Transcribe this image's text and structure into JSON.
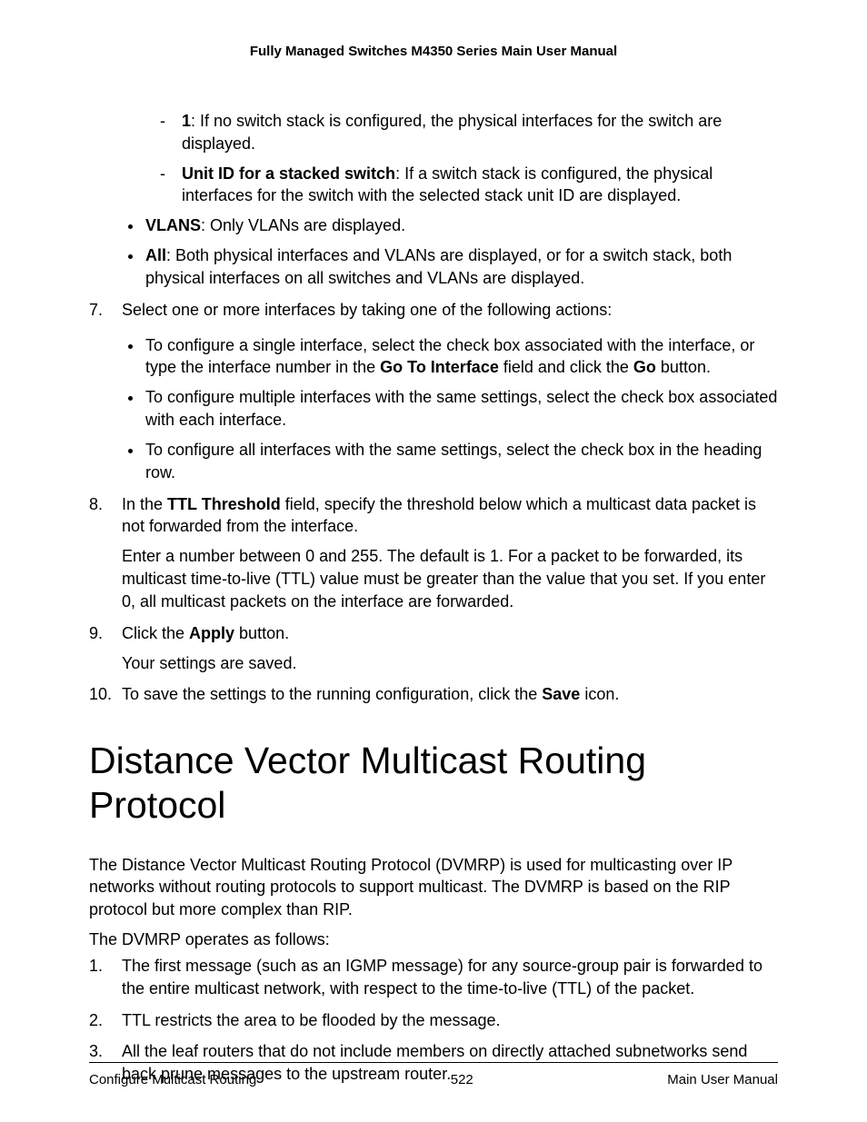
{
  "header": {
    "title": "Fully Managed Switches M4350 Series Main User Manual"
  },
  "dash": {
    "i0b": "1",
    "i0r": ": If no switch stack is configured, the physical interfaces for the switch are displayed.",
    "i1b": "Unit ID for a stacked switch",
    "i1r": ": If a switch stack is configured, the physical interfaces for the switch with the selected stack unit ID are displayed."
  },
  "bulletsA": {
    "b0b": "VLANS",
    "b0r": ": Only VLANs are displayed.",
    "b1b": "All",
    "b1r": ": Both physical interfaces and VLANs are displayed, or for a switch stack, both physical interfaces on all switches and VLANs are displayed."
  },
  "step7": {
    "num": "7.",
    "text": "Select one or more interfaces by taking one of the following actions:",
    "b0a": "To configure a single interface, select the check box associated with the interface, or type the interface number in the ",
    "b0f": "Go To Interface",
    "b0m": " field and click the ",
    "b0g": "Go",
    "b0e": " button.",
    "b1": "To configure multiple interfaces with the same settings, select the check box associated with each interface.",
    "b2": "To configure all interfaces with the same settings, select the check box in the heading row."
  },
  "step8": {
    "num": "8.",
    "t0a": "In the ",
    "t0b": "TTL Threshold",
    "t0c": " field, specify the threshold below which a multicast data packet is not forwarded from the interface.",
    "p1": "Enter a number between 0 and 255. The default is 1. For a packet to be forwarded, its multicast time-to-live (TTL) value must be greater than the value that you set. If you enter 0, all multicast packets on the interface are forwarded."
  },
  "step9": {
    "num": "9.",
    "t0a": "Click the ",
    "t0b": "Apply",
    "t0c": " button.",
    "p1": "Your settings are saved."
  },
  "step10": {
    "num": "10.",
    "t0a": "To save the settings to the running configuration, click the ",
    "t0b": "Save",
    "t0c": " icon."
  },
  "section": {
    "title": "Distance Vector Multicast Routing Protocol",
    "p1": "The Distance Vector Multicast Routing Protocol (DVMRP) is used for multicasting over IP networks without routing protocols to support multicast. The DVMRP is based on the RIP protocol but more complex than RIP.",
    "p2": "The DVMRP operates as follows:",
    "n1num": "1.",
    "n1": "The first message (such as an IGMP message) for any source-group pair is forwarded to the entire multicast network, with respect to the time-to-live (TTL) of the packet.",
    "n2num": "2.",
    "n2": "TTL restricts the area to be flooded by the message.",
    "n3num": "3.",
    "n3": "All the leaf routers that do not include members on directly attached subnetworks send back prune messages to the upstream router."
  },
  "footer": {
    "left": "Configure Multicast Routing",
    "center": "522",
    "right": "Main User Manual"
  }
}
